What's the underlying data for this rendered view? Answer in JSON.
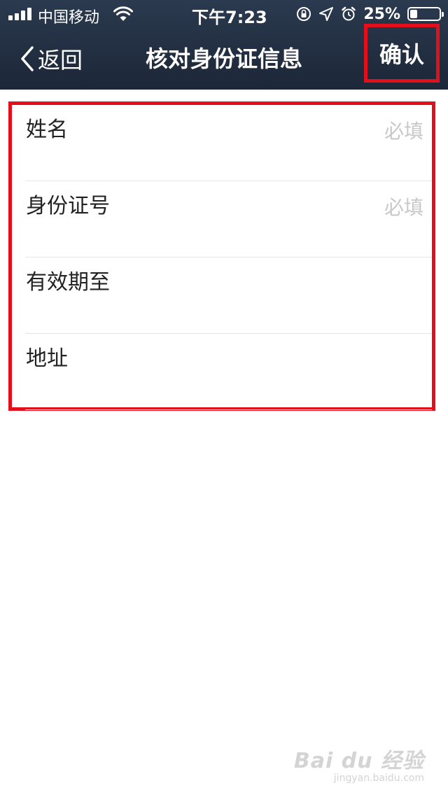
{
  "status_bar": {
    "carrier": "中国移动",
    "time": "下午7:23",
    "battery_percent": "25%",
    "battery_level": 0.25,
    "icons": [
      "signal-icon",
      "wifi-icon",
      "orientation-lock-icon",
      "location-icon",
      "alarm-icon",
      "battery-icon"
    ]
  },
  "nav": {
    "back_label": "返回",
    "title": "核对身份证信息",
    "confirm_label": "确认"
  },
  "form": {
    "rows": [
      {
        "label": "姓名",
        "placeholder": "必填"
      },
      {
        "label": "身份证号",
        "placeholder": "必填"
      },
      {
        "label": "有效期至",
        "placeholder": ""
      },
      {
        "label": "地址",
        "placeholder": ""
      }
    ]
  },
  "watermark": {
    "logo_text": "Bai du 经验",
    "url": "jingyan.baidu.com"
  },
  "colors": {
    "header_bg": "#1f2b3c",
    "highlight_red": "#e3101c",
    "placeholder_gray": "#c8c8c8"
  }
}
